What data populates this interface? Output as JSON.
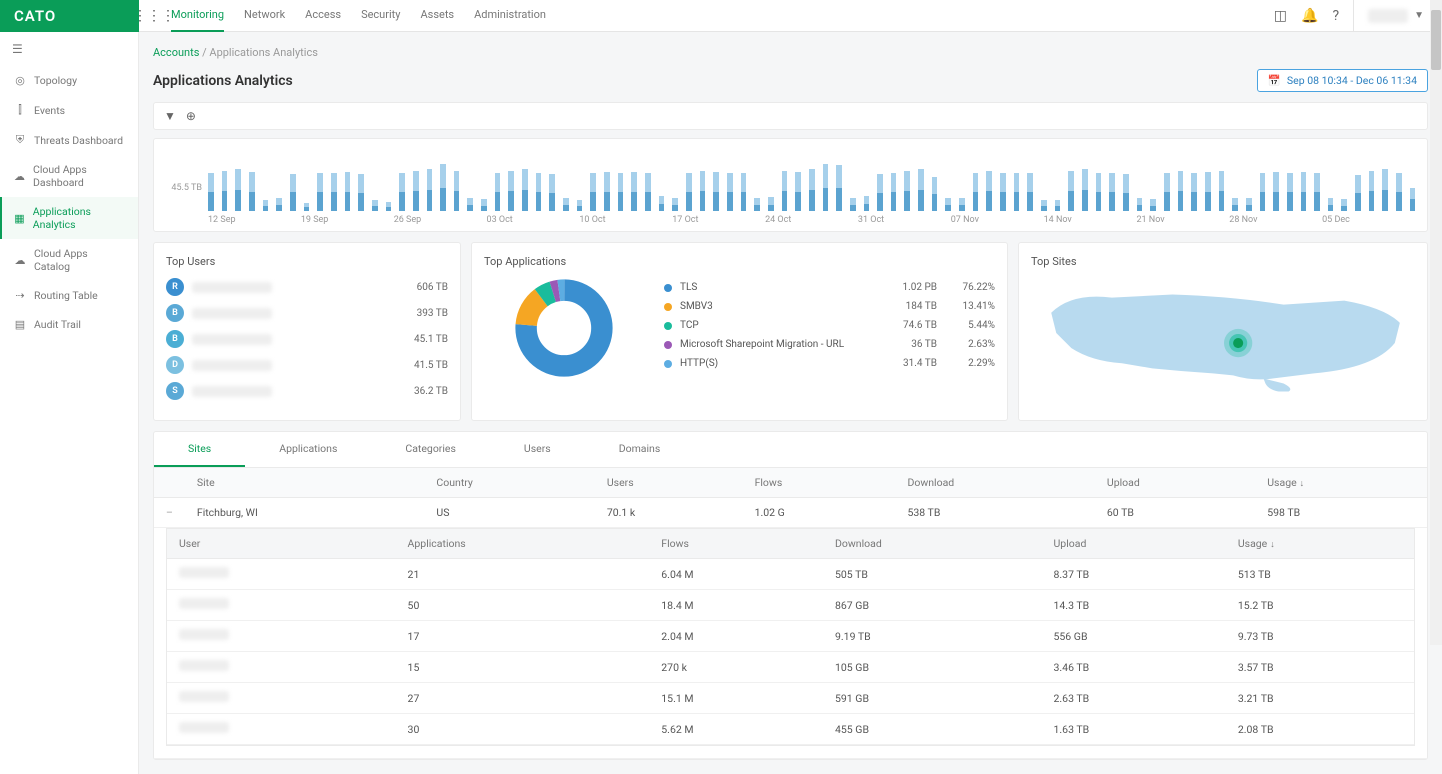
{
  "brand": "CATO",
  "top_nav": [
    "Monitoring",
    "Network",
    "Access",
    "Security",
    "Assets",
    "Administration"
  ],
  "top_nav_active": 0,
  "sidebar": [
    {
      "icon": "◎",
      "label": "Topology"
    },
    {
      "icon": "⫿",
      "label": "Events"
    },
    {
      "icon": "⛨",
      "label": "Threats Dashboard"
    },
    {
      "icon": "☁",
      "label": "Cloud Apps Dashboard"
    },
    {
      "icon": "▦",
      "label": "Applications Analytics"
    },
    {
      "icon": "☁",
      "label": "Cloud Apps Catalog"
    },
    {
      "icon": "⇢",
      "label": "Routing Table"
    },
    {
      "icon": "▤",
      "label": "Audit Trail"
    }
  ],
  "sidebar_active": 4,
  "breadcrumb": {
    "root": "Accounts",
    "sep": "/",
    "current": "Applications Analytics"
  },
  "page_title": "Applications Analytics",
  "date_range": "Sep 08 10:34 - Dec 06 11:34",
  "timeline_ylabel": "45.5 TB",
  "timeline_xticks": [
    "12 Sep",
    "19 Sep",
    "26 Sep",
    "03 Oct",
    "10 Oct",
    "17 Oct",
    "24 Oct",
    "31 Oct",
    "07 Nov",
    "14 Nov",
    "21 Nov",
    "28 Nov",
    "05 Dec"
  ],
  "top_users_title": "Top Users",
  "top_users": [
    {
      "initial": "R",
      "color": "#3a8fd0",
      "value": "606 TB"
    },
    {
      "initial": "B",
      "color": "#5aa9d6",
      "value": "393 TB"
    },
    {
      "initial": "B",
      "color": "#4baed4",
      "value": "45.1 TB"
    },
    {
      "initial": "D",
      "color": "#7cc0e0",
      "value": "41.5 TB"
    },
    {
      "initial": "S",
      "color": "#5aa9d6",
      "value": "36.2 TB"
    }
  ],
  "top_apps_title": "Top Applications",
  "top_apps": [
    {
      "color": "#3a8fd0",
      "name": "TLS",
      "value": "1.02 PB",
      "pct": "76.22%"
    },
    {
      "color": "#f5a623",
      "name": "SMBV3",
      "value": "184 TB",
      "pct": "13.41%"
    },
    {
      "color": "#1abc9c",
      "name": "TCP",
      "value": "74.6 TB",
      "pct": "5.44%"
    },
    {
      "color": "#9b59b6",
      "name": "Microsoft Sharepoint Migration - URL",
      "value": "36 TB",
      "pct": "2.63%"
    },
    {
      "color": "#5dade2",
      "name": "HTTP(S)",
      "value": "31.4 TB",
      "pct": "2.29%"
    }
  ],
  "top_sites_title": "Top Sites",
  "data_tabs": [
    "Sites",
    "Applications",
    "Categories",
    "Users",
    "Domains"
  ],
  "data_tab_active": 0,
  "sites_columns": [
    "",
    "Site",
    "Country",
    "Users",
    "Flows",
    "Download",
    "Upload",
    "Usage"
  ],
  "sites_sort_col": "Usage",
  "site_row": {
    "name": "Fitchburg, WI",
    "country": "US",
    "users": "70.1 k",
    "flows": "1.02 G",
    "download": "538 TB",
    "upload": "60 TB",
    "usage": "598 TB"
  },
  "users_columns": [
    "User",
    "Applications",
    "Flows",
    "Download",
    "Upload",
    "Usage"
  ],
  "users_sort_col": "Usage",
  "user_rows": [
    {
      "apps": "21",
      "flows": "6.04 M",
      "download": "505 TB",
      "upload": "8.37 TB",
      "usage": "513 TB"
    },
    {
      "apps": "50",
      "flows": "18.4 M",
      "download": "867 GB",
      "upload": "14.3 TB",
      "usage": "15.2 TB"
    },
    {
      "apps": "17",
      "flows": "2.04 M",
      "download": "9.19 TB",
      "upload": "556 GB",
      "usage": "9.73 TB"
    },
    {
      "apps": "15",
      "flows": "270 k",
      "download": "105 GB",
      "upload": "3.46 TB",
      "usage": "3.57 TB"
    },
    {
      "apps": "27",
      "flows": "15.1 M",
      "download": "591 GB",
      "upload": "2.63 TB",
      "usage": "3.21 TB"
    },
    {
      "apps": "30",
      "flows": "5.62 M",
      "download": "455 GB",
      "upload": "1.63 TB",
      "usage": "2.08 TB"
    }
  ],
  "chart_data": {
    "timeline": {
      "type": "bar",
      "ylabel": "45.5 TB",
      "categories": [
        "08 Sep",
        "09 Sep",
        "10 Sep",
        "11 Sep",
        "12 Sep",
        "13 Sep",
        "14 Sep",
        "15 Sep",
        "16 Sep",
        "17 Sep",
        "18 Sep",
        "19 Sep",
        "20 Sep",
        "21 Sep",
        "22 Sep",
        "23 Sep",
        "24 Sep",
        "25 Sep",
        "26 Sep",
        "27 Sep",
        "28 Sep",
        "29 Sep",
        "30 Sep",
        "01 Oct",
        "02 Oct",
        "03 Oct",
        "04 Oct",
        "05 Oct",
        "06 Oct",
        "07 Oct",
        "08 Oct",
        "09 Oct",
        "10 Oct",
        "11 Oct",
        "12 Oct",
        "13 Oct",
        "14 Oct",
        "15 Oct",
        "16 Oct",
        "17 Oct",
        "18 Oct",
        "19 Oct",
        "20 Oct",
        "21 Oct",
        "22 Oct",
        "23 Oct",
        "24 Oct",
        "25 Oct",
        "26 Oct",
        "27 Oct",
        "28 Oct",
        "29 Oct",
        "30 Oct",
        "31 Oct",
        "01 Nov",
        "02 Nov",
        "03 Nov",
        "04 Nov",
        "05 Nov",
        "06 Nov",
        "07 Nov",
        "08 Nov",
        "09 Nov",
        "10 Nov",
        "11 Nov",
        "12 Nov",
        "13 Nov",
        "14 Nov",
        "15 Nov",
        "16 Nov",
        "17 Nov",
        "18 Nov",
        "19 Nov",
        "20 Nov",
        "21 Nov",
        "22 Nov",
        "23 Nov",
        "24 Nov",
        "25 Nov",
        "26 Nov",
        "27 Nov",
        "28 Nov",
        "29 Nov",
        "30 Nov",
        "01 Dec",
        "02 Dec",
        "03 Dec",
        "04 Dec",
        "05 Dec"
      ],
      "series": [
        {
          "name": "upper",
          "values": [
            36,
            38,
            40,
            37,
            10,
            12,
            35,
            8,
            36,
            36,
            37,
            35,
            10,
            9,
            36,
            38,
            40,
            45,
            38,
            12,
            11,
            36,
            38,
            40,
            36,
            35,
            12,
            10,
            36,
            37,
            36,
            37,
            36,
            14,
            12,
            36,
            38,
            37,
            36,
            36,
            12,
            13,
            38,
            37,
            40,
            45,
            44,
            12,
            14,
            35,
            36,
            38,
            40,
            32,
            12,
            12,
            36,
            38,
            36,
            36,
            36,
            10,
            10,
            38,
            40,
            36,
            36,
            35,
            12,
            11,
            36,
            38,
            36,
            37,
            38,
            12,
            12,
            36,
            37,
            36,
            37,
            36,
            12,
            11,
            34,
            38,
            40,
            36,
            22
          ]
        },
        {
          "name": "lower",
          "values": [
            18,
            19,
            20,
            18,
            5,
            6,
            18,
            4,
            18,
            18,
            18,
            17,
            5,
            4,
            18,
            19,
            20,
            22,
            19,
            6,
            5,
            18,
            19,
            20,
            18,
            17,
            6,
            5,
            18,
            18,
            18,
            18,
            18,
            7,
            6,
            18,
            19,
            18,
            18,
            18,
            6,
            6,
            19,
            18,
            20,
            22,
            22,
            6,
            7,
            17,
            18,
            19,
            20,
            16,
            6,
            6,
            18,
            19,
            18,
            18,
            18,
            5,
            5,
            19,
            20,
            18,
            18,
            17,
            6,
            5,
            18,
            19,
            18,
            18,
            19,
            6,
            6,
            18,
            18,
            18,
            18,
            18,
            6,
            5,
            17,
            19,
            20,
            18,
            11
          ]
        }
      ],
      "ylim": [
        0,
        45.5
      ]
    },
    "donut": {
      "type": "pie",
      "series": [
        {
          "name": "TLS",
          "value": 76.22,
          "color": "#3a8fd0"
        },
        {
          "name": "SMBV3",
          "value": 13.41,
          "color": "#f5a623"
        },
        {
          "name": "TCP",
          "value": 5.44,
          "color": "#1abc9c"
        },
        {
          "name": "Microsoft Sharepoint Migration - URL",
          "value": 2.63,
          "color": "#9b59b6"
        },
        {
          "name": "HTTP(S)",
          "value": 2.29,
          "color": "#5dade2"
        }
      ]
    }
  }
}
